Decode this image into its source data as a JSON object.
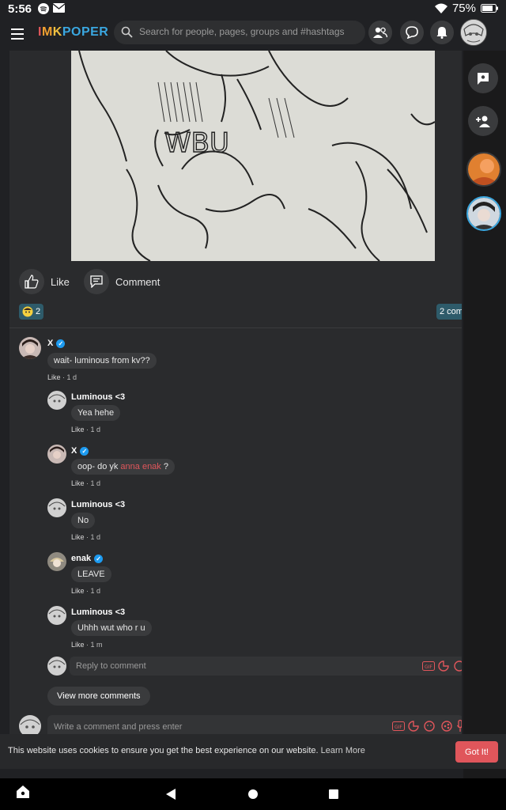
{
  "status_bar": {
    "time": "5:56",
    "battery": "75%"
  },
  "header": {
    "logo_parts": [
      {
        "text": "I",
        "color": "#e0565b"
      },
      {
        "text": "M",
        "color": "#f0a030"
      },
      {
        "text": "K",
        "color": "#f0c040"
      },
      {
        "text": "POPER",
        "color": "#3aa7e0"
      }
    ],
    "search_placeholder": "Search for people, pages, groups and #hashtags"
  },
  "post": {
    "actions": {
      "like": "Like",
      "comment": "Comment"
    },
    "reaction_count": "2",
    "comments_count": "2 com",
    "comments": [
      {
        "name": "X",
        "verified": true,
        "text": "wait- luminous from kv??",
        "like": "Like",
        "time": "1 d"
      },
      {
        "name": "Luminous <3",
        "verified": false,
        "text": "Yea hehe",
        "like": "Like",
        "time": "1 d"
      },
      {
        "name": "X",
        "verified": true,
        "text_before": "oop- do yk ",
        "mention": "anna enak",
        "text_after": " ?",
        "like": "Like",
        "time": "1 d"
      },
      {
        "name": "Luminous <3",
        "verified": false,
        "text": "No",
        "like": "Like",
        "time": "1 d"
      },
      {
        "name": "enak",
        "verified": true,
        "text": "LEAVE",
        "like": "Like",
        "time": "1 d"
      },
      {
        "name": "Luminous <3",
        "verified": false,
        "text": "Uhhh wut who r u",
        "like": "Like",
        "time": "1 m"
      }
    ],
    "reply_placeholder": "Reply to comment",
    "view_more": "View more comments",
    "write_placeholder": "Write a comment and press enter"
  },
  "cookie_banner": {
    "text": "This website uses cookies to ensure you get the best experience on our website.",
    "learn_more": "Learn More",
    "button": "Got It!"
  },
  "colors": {
    "accent": "#e0565b",
    "verified": "#1d9bf0",
    "badge": "#2e5b6a"
  }
}
